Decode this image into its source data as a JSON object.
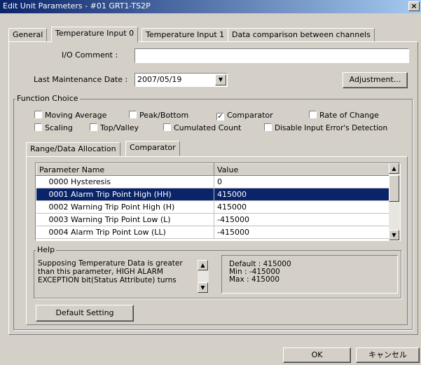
{
  "window": {
    "title": "Edit Unit Parameters - #01 GRT1-TS2P",
    "close_label": "×"
  },
  "tabs": [
    "General",
    "Temperature Input 0",
    "Temperature Input 1",
    "Data comparison between channels"
  ],
  "io_comment": {
    "label": "I/O Comment :",
    "value": ""
  },
  "maintenance": {
    "label": "Last Maintenance Date :",
    "value": "2007/05/19",
    "adjustment_label": "Adjustment..."
  },
  "function_choice": {
    "title": "Function Choice",
    "items": [
      {
        "label": "Moving Average",
        "checked": false
      },
      {
        "label": "Peak/Bottom",
        "checked": false
      },
      {
        "label": "Comparator",
        "checked": true
      },
      {
        "label": "Rate of Change",
        "checked": false
      },
      {
        "label": "Scaling",
        "checked": false
      },
      {
        "label": "Top/Valley",
        "checked": false
      },
      {
        "label": "Cumulated Count",
        "checked": false
      },
      {
        "label": "Disable Input Error's Detection",
        "checked": false
      }
    ]
  },
  "subtabs": [
    "Range/Data Allocation",
    "Comparator"
  ],
  "params": {
    "headers": [
      "Parameter Name",
      "Value"
    ],
    "rows": [
      {
        "name": "0000 Hysteresis",
        "value": "0"
      },
      {
        "name": "0001 Alarm Trip Point High (HH)",
        "value": "415000"
      },
      {
        "name": "0002 Warning Trip Point High (H)",
        "value": "415000"
      },
      {
        "name": "0003 Warning Trip Point Low (L)",
        "value": "-415000"
      },
      {
        "name": "0004 Alarm Trip Point Low (LL)",
        "value": "-415000"
      }
    ],
    "selected_row": 1
  },
  "help": {
    "title": "Help",
    "text_lines": [
      "Supposing Temperature Data is greater",
      "than this parameter, HIGH ALARM",
      "EXCEPTION bit(Status Attribute) turns"
    ],
    "default": "Default : 415000",
    "min": "Min : -415000",
    "max": "Max : 415000"
  },
  "default_setting_label": "Default Setting",
  "ok_label": "OK",
  "cancel_label": "キャンセル",
  "icons": {
    "dropdown": "▼",
    "scroll_up": "▲",
    "scroll_down": "▼",
    "check": "✓"
  }
}
